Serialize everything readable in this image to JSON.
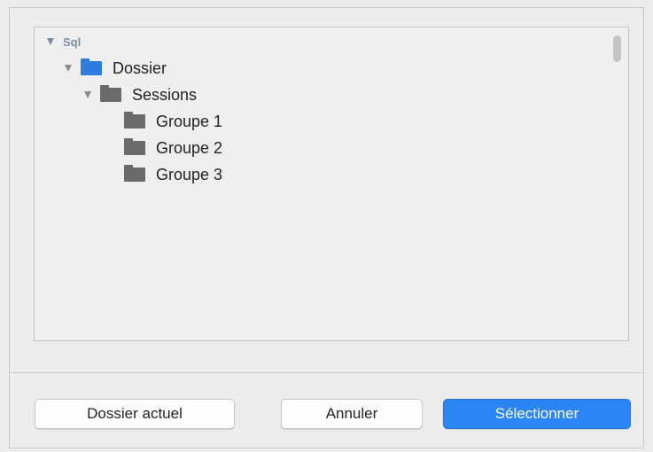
{
  "tree": {
    "root": "Sql",
    "items": [
      {
        "label": "Dossier",
        "icon": "folder-blue-icon"
      },
      {
        "label": "Sessions",
        "icon": "folder-gray-icon"
      },
      {
        "label": "Groupe 1",
        "icon": "folder-gray-icon"
      },
      {
        "label": "Groupe 2",
        "icon": "folder-gray-icon"
      },
      {
        "label": "Groupe 3",
        "icon": "folder-gray-icon"
      }
    ]
  },
  "buttons": {
    "current": "Dossier actuel",
    "cancel": "Annuler",
    "select": "Sélectionner"
  },
  "colors": {
    "accent": "#2b85f5",
    "folder_blue": "#2d7ce0",
    "folder_gray": "#6a6a6a",
    "root_text": "#7d8ea3"
  }
}
